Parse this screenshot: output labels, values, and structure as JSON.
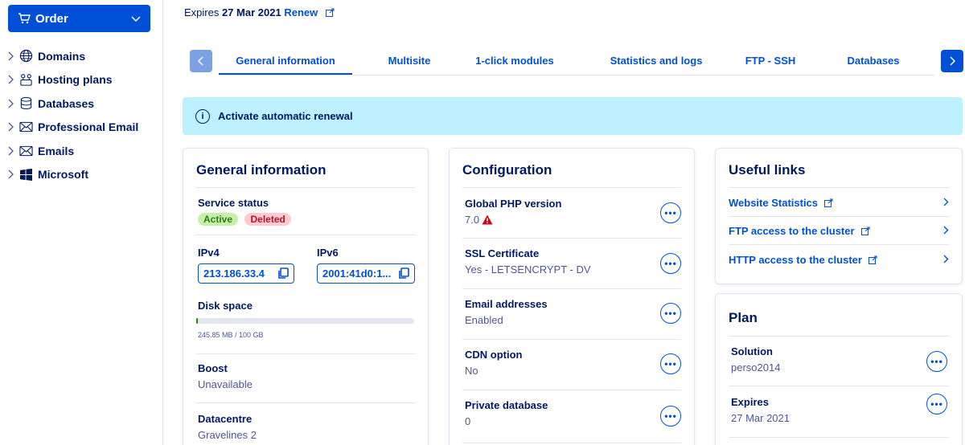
{
  "sidebar": {
    "order_label": "Order",
    "items": [
      {
        "label": "Domains",
        "icon": "globe-icon"
      },
      {
        "label": "Hosting plans",
        "icon": "hosting-icon"
      },
      {
        "label": "Databases",
        "icon": "database-icon"
      },
      {
        "label": "Professional Email",
        "icon": "envelope-icon"
      },
      {
        "label": "Emails",
        "icon": "envelope-icon"
      },
      {
        "label": "Microsoft",
        "icon": "microsoft-icon"
      }
    ]
  },
  "header": {
    "expires_prefix": "Expires",
    "expires_date": "27 Mar 2021",
    "renew_label": "Renew"
  },
  "tabs": [
    {
      "label": "General information",
      "active": true
    },
    {
      "label": "Multisite"
    },
    {
      "label": "1-click modules"
    },
    {
      "label": "Statistics and logs"
    },
    {
      "label": "FTP - SSH"
    },
    {
      "label": "Databases"
    }
  ],
  "banner": {
    "text": "Activate automatic renewal"
  },
  "general": {
    "title": "General information",
    "service_status_label": "Service status",
    "badge_active": "Active",
    "badge_deleted": "Deleted",
    "ipv4_label": "IPv4",
    "ipv4_value": "213.186.33.4",
    "ipv6_label": "IPv6",
    "ipv6_value": "2001:41d0:1...",
    "disk_label": "Disk space",
    "disk_usage_text": "245.85 MB / 100 GB",
    "disk_usage_fraction": 0.0024,
    "boost_label": "Boost",
    "boost_value": "Unavailable",
    "datacentre_label": "Datacentre",
    "datacentre_value": "Gravelines 2"
  },
  "configuration": {
    "title": "Configuration",
    "items": [
      {
        "label": "Global PHP version",
        "value": "7.0"
      },
      {
        "label": "SSL Certificate",
        "value": "Yes - LETSENCRYPT - DV"
      },
      {
        "label": "Email addresses",
        "value": "Enabled"
      },
      {
        "label": "CDN option",
        "value": "No"
      },
      {
        "label": "Private database",
        "value": "0"
      }
    ]
  },
  "useful_links": {
    "title": "Useful links",
    "links": [
      {
        "label": "Website Statistics"
      },
      {
        "label": "FTP access to the cluster"
      },
      {
        "label": "HTTP access to the cluster"
      }
    ]
  },
  "plan": {
    "title": "Plan",
    "solution_label": "Solution",
    "solution_value": "perso2014",
    "expires_label": "Expires",
    "expires_value": "27 Mar 2021"
  },
  "colors": {
    "primary": "#0050d7",
    "text": "#00185e",
    "banner_bg": "#bef1ff",
    "active_badge": "#c6f0a8",
    "deleted_badge": "#ffcbd3"
  }
}
